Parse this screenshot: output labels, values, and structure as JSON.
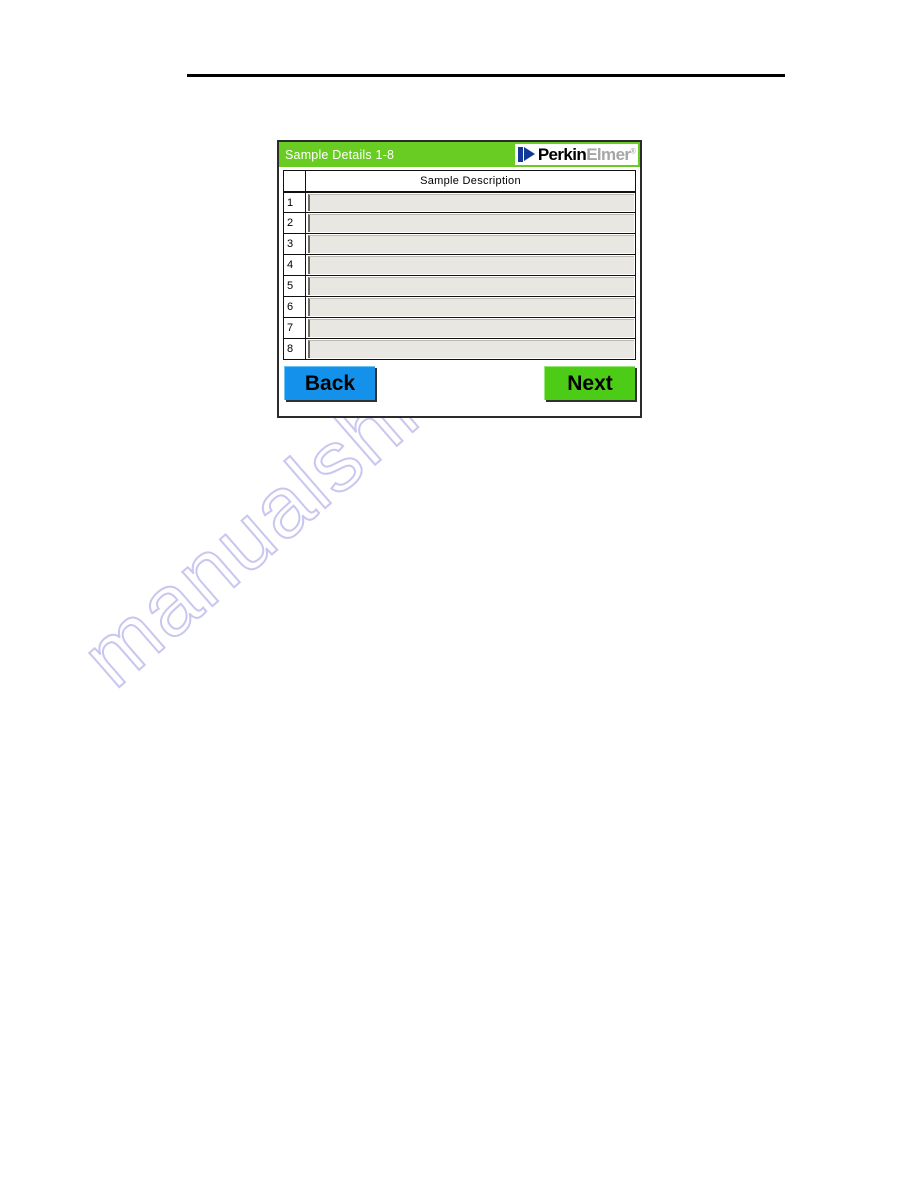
{
  "page": {
    "watermark": "manualshive.com"
  },
  "dialog": {
    "title": "Sample Details 1-8",
    "logo": {
      "mark": "perkinelmer-p-mark",
      "word_first": "Perkin",
      "word_second": "Elmer",
      "trademark": "®"
    },
    "table": {
      "index_header": "",
      "description_header": "Sample Description",
      "rows": [
        {
          "index": "1",
          "description": ""
        },
        {
          "index": "2",
          "description": ""
        },
        {
          "index": "3",
          "description": ""
        },
        {
          "index": "4",
          "description": ""
        },
        {
          "index": "5",
          "description": ""
        },
        {
          "index": "6",
          "description": ""
        },
        {
          "index": "7",
          "description": ""
        },
        {
          "index": "8",
          "description": ""
        }
      ]
    },
    "buttons": {
      "back": "Back",
      "next": "Next"
    }
  },
  "colors": {
    "titlebar_green": "#69cc22",
    "next_green": "#4ccc16",
    "back_blue": "#1492eb",
    "field_beige": "#e9e7e1",
    "logo_blue": "#10389b",
    "logo_gray": "#a6a6a6",
    "watermark_lavender": "#c9c6ef"
  }
}
